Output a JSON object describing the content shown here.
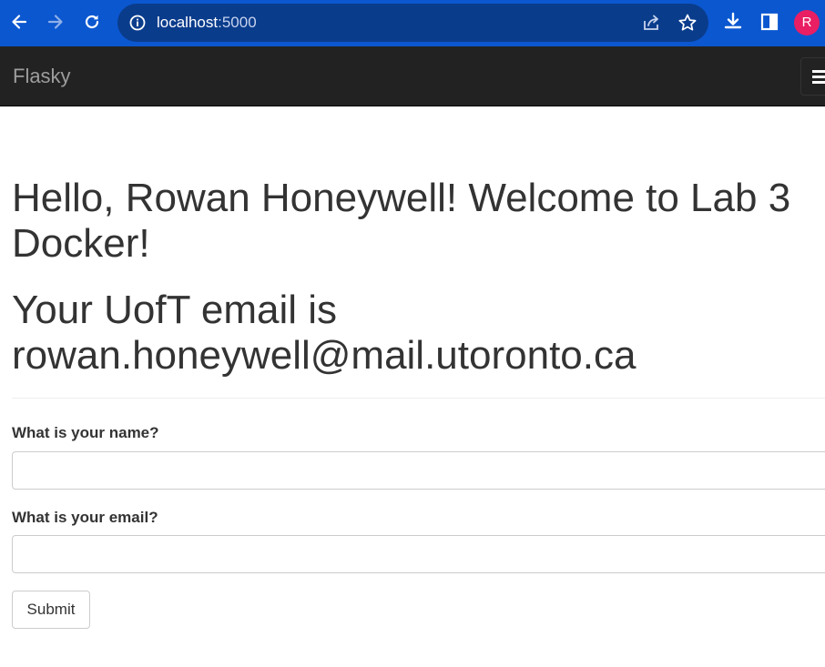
{
  "browser": {
    "url_host": "localhost",
    "url_port": ":5000",
    "profile_initial": "R",
    "icons": [
      "back-arrow-icon",
      "forward-arrow-icon",
      "reload-icon",
      "site-info-icon",
      "share-icon",
      "bookmark-star-icon",
      "download-icon",
      "side-panel-icon"
    ],
    "chrome_color": "#0b57d0",
    "avatar_color": "#e91e63"
  },
  "navbar": {
    "brand": "Flasky",
    "background": "#222222",
    "toggle_icon": "hamburger-menu-icon"
  },
  "page": {
    "greeting": "Hello, Rowan Honeywell! Welcome to Lab 3 Docker!",
    "email_message": "Your UofT email is rowan.honeywell@mail.utoronto.ca"
  },
  "form": {
    "name_label": "What is your name?",
    "name_value": "",
    "email_label": "What is your email?",
    "email_value": "",
    "submit_label": "Submit"
  }
}
